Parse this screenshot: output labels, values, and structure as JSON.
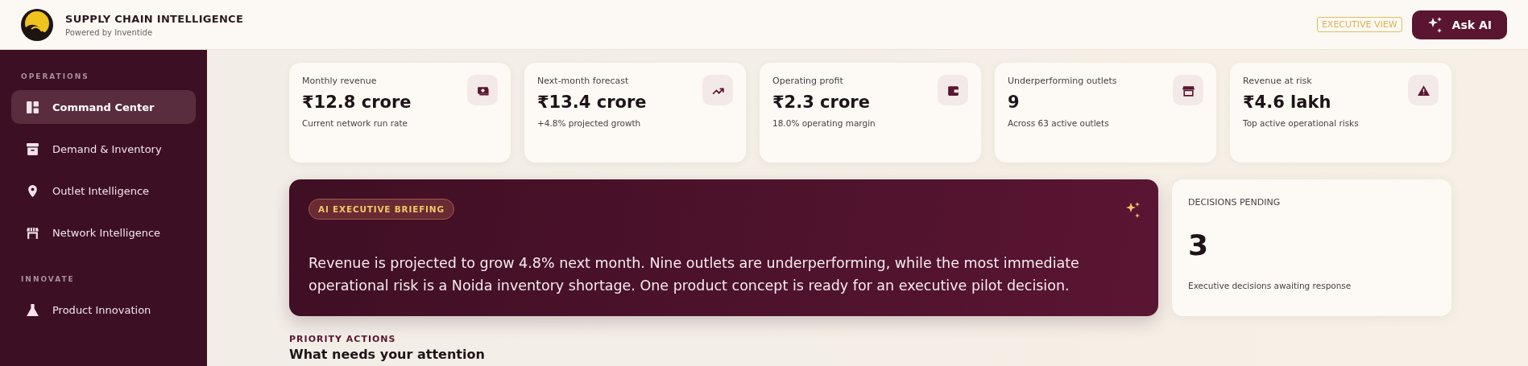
{
  "header": {
    "title": "SUPPLY CHAIN INTELLIGENCE",
    "subtitle": "Powered by Inventide",
    "view_badge": "EXECUTIVE VIEW",
    "ask_button": "Ask AI"
  },
  "sidebar": {
    "sections": [
      {
        "heading": "OPERATIONS",
        "items": [
          {
            "label": "Command Center",
            "selected": true
          },
          {
            "label": "Demand & Inventory",
            "selected": false
          },
          {
            "label": "Outlet Intelligence",
            "selected": false
          },
          {
            "label": "Network Intelligence",
            "selected": false
          }
        ]
      },
      {
        "heading": "INNOVATE",
        "items": [
          {
            "label": "Product Innovation",
            "selected": false
          }
        ]
      }
    ]
  },
  "kpis": [
    {
      "label": "Monthly revenue",
      "value": "₹12.8 crore",
      "note": "Current network run rate"
    },
    {
      "label": "Next-month forecast",
      "value": "₹13.4 crore",
      "note": "+4.8% projected growth"
    },
    {
      "label": "Operating profit",
      "value": "₹2.3 crore",
      "note": "18.0% operating margin"
    },
    {
      "label": "Underperforming outlets",
      "value": "9",
      "note": "Across 63 active outlets"
    },
    {
      "label": "Revenue at risk",
      "value": "₹4.6 lakh",
      "note": "Top active operational risks"
    }
  ],
  "briefing": {
    "badge": "AI EXECUTIVE BRIEFING",
    "text": "Revenue is projected to grow 4.8% next month. Nine outlets are underperforming, while the most immediate operational risk is a Noida inventory shortage. One product concept is ready for an executive pilot decision."
  },
  "decisions": {
    "label": "DECISIONS PENDING",
    "value": "3",
    "note": "Executive decisions awaiting response"
  },
  "priority": {
    "eyebrow": "PRIORITY ACTIONS",
    "title": "What needs your attention"
  }
}
